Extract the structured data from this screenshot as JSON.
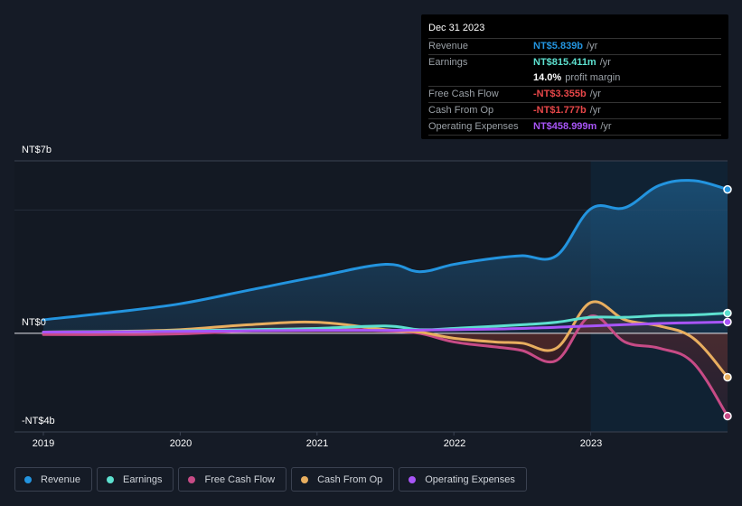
{
  "tooltip": {
    "date": "Dec 31 2023",
    "rows": [
      {
        "label": "Revenue",
        "value": "NT$5.839b",
        "unit": "/yr",
        "color": "#2394df"
      },
      {
        "label": "Earnings",
        "value": "NT$815.411m",
        "unit": "/yr",
        "color": "#5de0cf"
      },
      {
        "label": "",
        "value": "14.0%",
        "unit": "profit margin",
        "color": "#ffffff"
      },
      {
        "label": "Free Cash Flow",
        "value": "-NT$3.355b",
        "unit": "/yr",
        "color": "#e84749"
      },
      {
        "label": "Cash From Op",
        "value": "-NT$1.777b",
        "unit": "/yr",
        "color": "#e84749"
      },
      {
        "label": "Operating Expenses",
        "value": "NT$458.999m",
        "unit": "/yr",
        "color": "#a855f7"
      }
    ]
  },
  "legend": [
    {
      "label": "Revenue",
      "color": "#2394df"
    },
    {
      "label": "Earnings",
      "color": "#5de0cf"
    },
    {
      "label": "Free Cash Flow",
      "color": "#c74b86"
    },
    {
      "label": "Cash From Op",
      "color": "#e8ae5f"
    },
    {
      "label": "Operating Expenses",
      "color": "#a855f7"
    }
  ],
  "chart_data": {
    "type": "line",
    "title": "",
    "xlabel": "",
    "ylabel": "",
    "y_tick_labels": [
      "NT$7b",
      "NT$0",
      "-NT$4b"
    ],
    "x_tick_labels": [
      "2019",
      "2020",
      "2021",
      "2022",
      "2023"
    ],
    "ylim": [
      -4,
      7
    ],
    "xlim": [
      2019.0,
      2024.0
    ],
    "unit": "NT$ billions",
    "highlight_from": 2023.0,
    "series": [
      {
        "name": "Revenue",
        "color": "#2394df",
        "x": [
          2019.0,
          2019.5,
          2020.0,
          2020.5,
          2021.0,
          2021.5,
          2021.75,
          2022.0,
          2022.3,
          2022.5,
          2022.75,
          2023.0,
          2023.25,
          2023.5,
          2023.75,
          2024.0
        ],
        "values": [
          0.55,
          0.85,
          1.2,
          1.75,
          2.3,
          2.8,
          2.5,
          2.8,
          3.05,
          3.15,
          3.15,
          5.05,
          5.1,
          6.0,
          6.2,
          5.84
        ]
      },
      {
        "name": "Earnings",
        "color": "#5de0cf",
        "x": [
          2019.0,
          2019.5,
          2020.0,
          2020.5,
          2021.0,
          2021.5,
          2021.75,
          2022.0,
          2022.5,
          2022.75,
          2023.0,
          2023.25,
          2023.5,
          2023.75,
          2024.0
        ],
        "values": [
          0.05,
          0.07,
          0.1,
          0.15,
          0.2,
          0.3,
          0.15,
          0.2,
          0.35,
          0.45,
          0.65,
          0.65,
          0.72,
          0.75,
          0.82
        ]
      },
      {
        "name": "Free Cash Flow",
        "color": "#c74b86",
        "x": [
          2019.0,
          2019.5,
          2020.0,
          2020.5,
          2021.0,
          2021.5,
          2021.75,
          2022.0,
          2022.3,
          2022.5,
          2022.75,
          2023.0,
          2023.25,
          2023.5,
          2023.75,
          2024.0
        ],
        "values": [
          -0.05,
          -0.05,
          -0.02,
          0.1,
          0.2,
          0.1,
          0.0,
          -0.35,
          -0.55,
          -0.7,
          -1.1,
          0.7,
          -0.35,
          -0.6,
          -1.2,
          -3.36
        ]
      },
      {
        "name": "Cash From Op",
        "color": "#e8ae5f",
        "x": [
          2019.0,
          2019.5,
          2020.0,
          2020.5,
          2021.0,
          2021.5,
          2021.75,
          2022.0,
          2022.3,
          2022.5,
          2022.75,
          2023.0,
          2023.25,
          2023.5,
          2023.75,
          2024.0
        ],
        "values": [
          0.05,
          0.08,
          0.15,
          0.35,
          0.45,
          0.15,
          0.05,
          -0.2,
          -0.35,
          -0.4,
          -0.6,
          1.25,
          0.55,
          0.3,
          -0.2,
          -1.78
        ]
      },
      {
        "name": "Operating Expenses",
        "color": "#a855f7",
        "x": [
          2019.0,
          2019.5,
          2020.0,
          2020.5,
          2021.0,
          2021.5,
          2022.0,
          2022.5,
          2023.0,
          2023.5,
          2024.0
        ],
        "values": [
          0.05,
          0.06,
          0.08,
          0.1,
          0.12,
          0.12,
          0.15,
          0.2,
          0.3,
          0.4,
          0.46
        ]
      }
    ]
  }
}
